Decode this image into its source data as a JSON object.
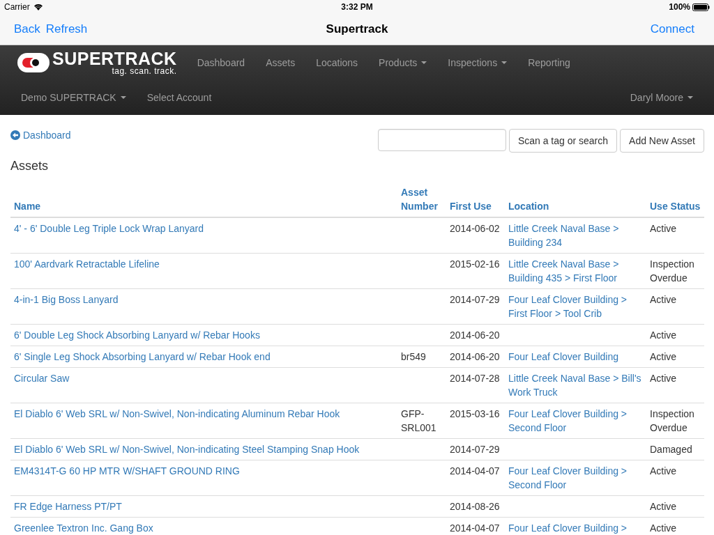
{
  "status_bar": {
    "carrier": "Carrier",
    "time": "3:32 PM",
    "battery": "100%"
  },
  "nav_bar": {
    "left_buttons": [
      "Back",
      "Refresh"
    ],
    "title": "Supertrack",
    "right_button": "Connect"
  },
  "app_nav": {
    "brand": "SUPERTRACK",
    "tagline": "tag. scan. track.",
    "menu": [
      {
        "label": "Dashboard",
        "dropdown": false
      },
      {
        "label": "Assets",
        "dropdown": false
      },
      {
        "label": "Locations",
        "dropdown": false
      },
      {
        "label": "Products",
        "dropdown": true
      },
      {
        "label": "Inspections",
        "dropdown": true
      },
      {
        "label": "Reporting",
        "dropdown": false
      }
    ],
    "account": {
      "label": "Demo SUPERTRACK",
      "dropdown": true
    },
    "select_account": "Select Account",
    "user": {
      "label": "Daryl Moore",
      "dropdown": true
    }
  },
  "breadcrumb": "Dashboard",
  "search_button": "Scan a tag or search",
  "add_button": "Add New Asset",
  "heading": "Assets",
  "table": {
    "columns": [
      "Name",
      "Asset Number",
      "First Use",
      "Location",
      "Use Status"
    ],
    "rows": [
      {
        "name": "4' - 6' Double Leg Triple Lock Wrap Lanyard",
        "asset_number": "",
        "first_use": "2014-06-02",
        "location": "Little Creek Naval Base > Building 234",
        "status": "Active"
      },
      {
        "name": "100' Aardvark Retractable Lifeline",
        "asset_number": "",
        "first_use": "2015-02-16",
        "location": "Little Creek Naval Base > Building 435 > First Floor",
        "status": "Inspection Overdue"
      },
      {
        "name": "4-in-1 Big Boss Lanyard",
        "asset_number": "",
        "first_use": "2014-07-29",
        "location": "Four Leaf Clover Building > First Floor > Tool Crib",
        "status": "Active"
      },
      {
        "name": "6' Double Leg Shock Absorbing Lanyard w/ Rebar Hooks",
        "asset_number": "",
        "first_use": "2014-06-20",
        "location": "",
        "status": "Active"
      },
      {
        "name": "6' Single Leg Shock Absorbing Lanyard w/ Rebar Hook end",
        "asset_number": "br549",
        "first_use": "2014-06-20",
        "location": "Four Leaf Clover Building",
        "status": "Active"
      },
      {
        "name": "Circular Saw",
        "asset_number": "",
        "first_use": "2014-07-28",
        "location": "Little Creek Naval Base > Bill's Work Truck",
        "status": "Active"
      },
      {
        "name": "El Diablo 6' Web SRL w/ Non-Swivel, Non-indicating Aluminum Rebar Hook",
        "asset_number": "GFP-SRL001",
        "first_use": "2015-03-16",
        "location": "Four Leaf Clover Building > Second Floor",
        "status": "Inspection Overdue"
      },
      {
        "name": "El Diablo 6' Web SRL w/ Non-Swivel, Non-indicating Steel Stamping Snap Hook",
        "asset_number": "",
        "first_use": "2014-07-29",
        "location": "",
        "status": "Damaged"
      },
      {
        "name": "EM4314T-G 60 HP MTR W/SHAFT GROUND RING",
        "asset_number": "",
        "first_use": "2014-04-07",
        "location": "Four Leaf Clover Building > Second Floor",
        "status": "Active"
      },
      {
        "name": "FR Edge Harness PT/PT",
        "asset_number": "",
        "first_use": "2014-08-26",
        "location": "",
        "status": "Active"
      },
      {
        "name": "Greenlee Textron Inc. Gang Box",
        "asset_number": "",
        "first_use": "2014-04-07",
        "location": "Four Leaf Clover Building >",
        "status": "Active"
      }
    ]
  }
}
